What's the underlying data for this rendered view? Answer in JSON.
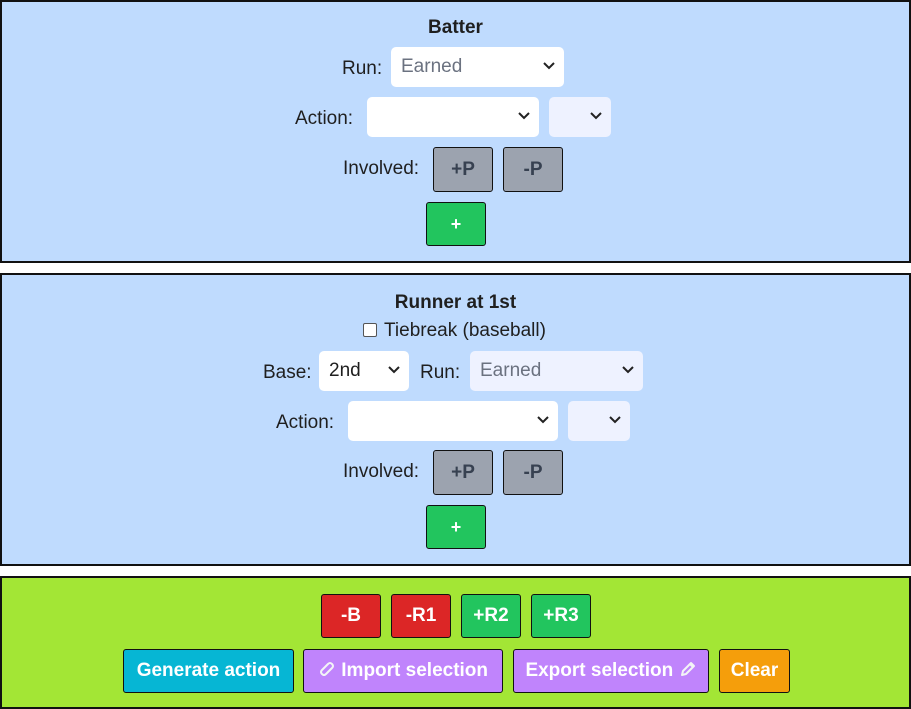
{
  "batter": {
    "title": "Batter",
    "run_label": "Run:",
    "run_value": "Earned",
    "action_label": "Action:",
    "action_value": "",
    "action_mod_value": "",
    "involved_label": "Involved:",
    "plus_p": "+P",
    "minus_p": "-P",
    "add": "+"
  },
  "runner": {
    "title": "Runner at 1st",
    "tiebreak_label": "Tiebreak (baseball)",
    "tiebreak_checked": false,
    "base_label": "Base:",
    "base_value": "2nd",
    "run_label": "Run:",
    "run_value": "Earned",
    "action_label": "Action:",
    "action_value": "",
    "action_mod_value": "",
    "involved_label": "Involved:",
    "plus_p": "+P",
    "minus_p": "-P",
    "add": "+"
  },
  "actions": {
    "minus_b": "-B",
    "minus_r1": "-R1",
    "plus_r2": "+R2",
    "plus_r3": "+R3",
    "generate": "Generate action",
    "import": "Import selection",
    "export": "Export selection",
    "clear": "Clear"
  },
  "icons": {
    "import": "paperclip-icon",
    "export": "pencil-icon",
    "select_chevron": "chevron-down-icon"
  },
  "colors": {
    "panel_blue": "#bfdbfe",
    "panel_green": "#a3e635",
    "red": "#dc2626",
    "green": "#22c55e",
    "cyan": "#06b6d4",
    "purple": "#c084fc",
    "orange": "#f59e0b",
    "gray": "#9ca3af"
  }
}
